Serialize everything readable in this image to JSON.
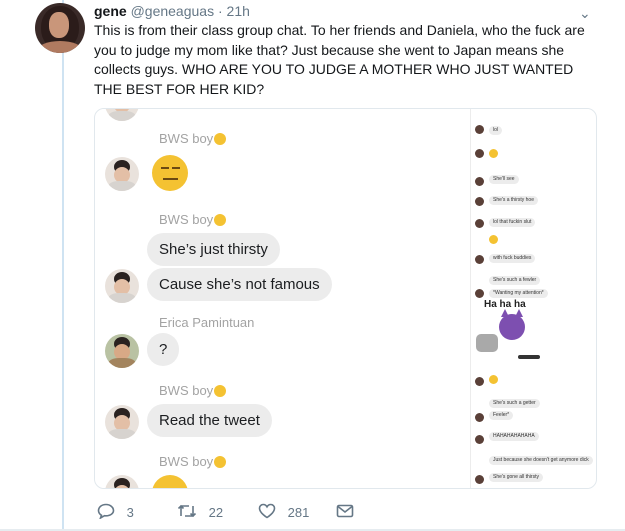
{
  "tweet": {
    "author_name": "gene",
    "handle": "@geneaguas",
    "separator": "·",
    "time": "21h",
    "text": "This is from their class group chat. To her friends and Daniela, who the fuck are you to judge my mom like that? Just because she went to Japan means she collects guys. WHO ARE YOU TO JUDGE A MOTHER WHO JUST WANTED THE BEST FOR HER KID?"
  },
  "chat": {
    "messages": [
      {
        "sender": "BWS boy",
        "text": ""
      },
      {
        "sender": "BWS boy",
        "text": "She’s just thirsty"
      },
      {
        "sender": "BWS boy",
        "text": "Cause she’s not famous"
      },
      {
        "sender": "Erica Pamintuan",
        "text": "?"
      },
      {
        "sender": "BWS boy",
        "text": "Read the tweet"
      },
      {
        "sender": "BWS boy",
        "text": ""
      }
    ],
    "side_messages": [
      "lol",
      "She'll see",
      "She's a thirsty hoe",
      "lol that fuckin slut",
      "with fuck buddies",
      "She's such a fewler",
      "*Wanting my attention*",
      "She's such a getter",
      "Feeler*",
      "HAHAHAHAHAHA",
      "Just because she doesn't get anymore dick",
      "She's gone all thirsty"
    ],
    "sticker_text": "Ha ha ha"
  },
  "actions": {
    "replies": "3",
    "retweets": "22",
    "likes": "281"
  },
  "colors": {
    "accent": "#1da1f2",
    "bubble": "#ececec",
    "muted": "#657786"
  }
}
